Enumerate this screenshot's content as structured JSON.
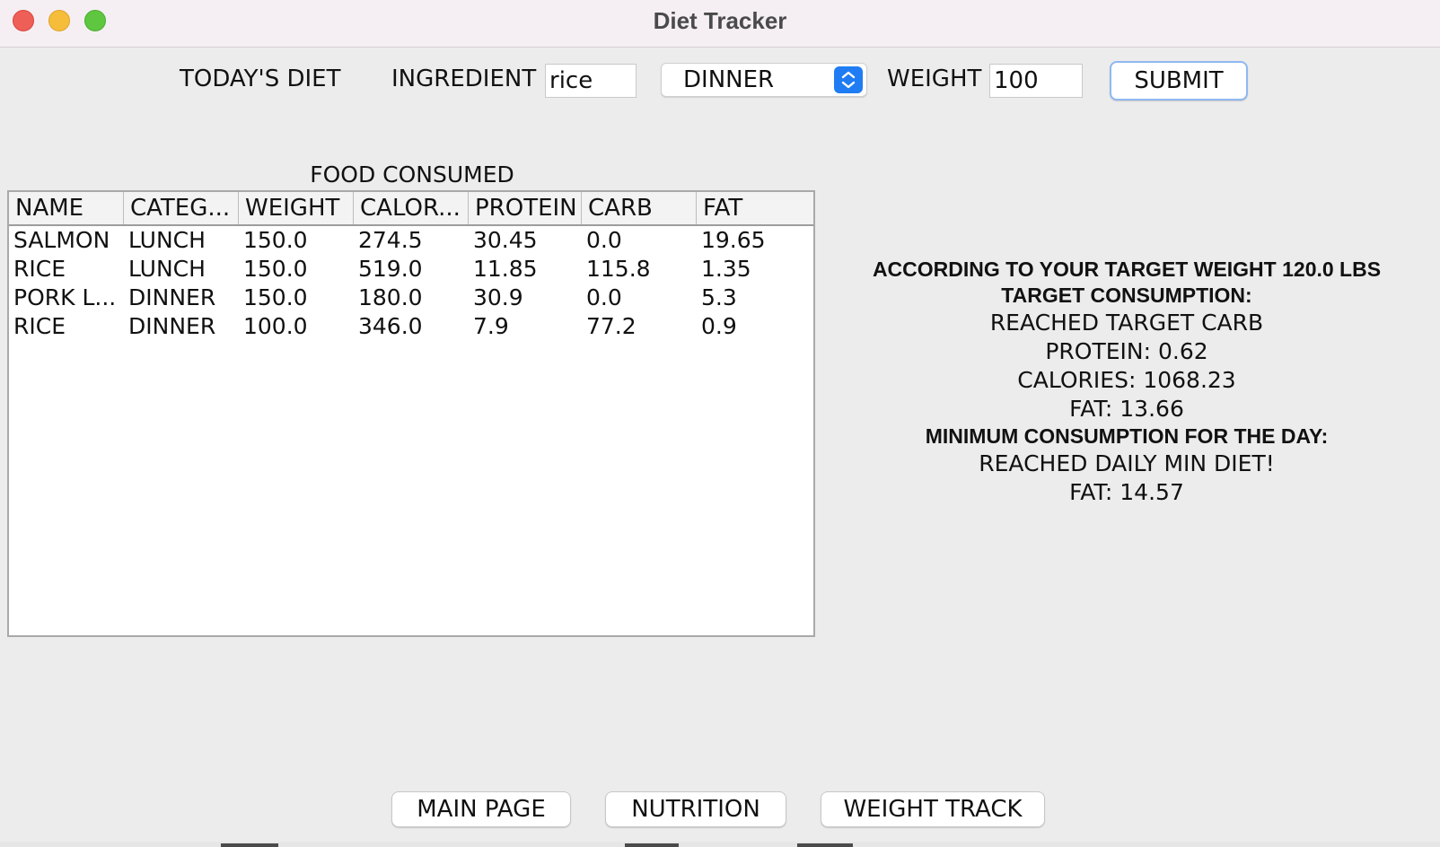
{
  "window": {
    "title": "Diet Tracker"
  },
  "form": {
    "todays_diet_label": "TODAY'S DIET",
    "ingredient_label": "INGREDIENT",
    "ingredient_value": "rice",
    "meal_selected": "DINNER",
    "weight_label": "WEIGHT",
    "weight_value": "100",
    "submit_label": "SUBMIT"
  },
  "table": {
    "title": "FOOD CONSUMED",
    "columns": [
      "NAME",
      "CATEG...",
      "WEIGHT",
      "CALOR...",
      "PROTEIN",
      "CARB",
      "FAT"
    ],
    "rows": [
      [
        "SALMON",
        "LUNCH",
        "150.0",
        "274.5",
        "30.45",
        "0.0",
        "19.65"
      ],
      [
        "RICE",
        "LUNCH",
        "150.0",
        "519.0",
        "11.85",
        "115.8",
        "1.35"
      ],
      [
        "PORK L...",
        "DINNER",
        "150.0",
        "180.0",
        "30.9",
        "0.0",
        "5.3"
      ],
      [
        "RICE",
        "DINNER",
        "100.0",
        "346.0",
        "7.9",
        "77.2",
        "0.9"
      ]
    ]
  },
  "summary": {
    "target_heading": "ACCORDING TO YOUR TARGET WEIGHT 120.0 LBS",
    "target_consumption_heading": "TARGET CONSUMPTION:",
    "target_lines": [
      "REACHED TARGET CARB",
      "PROTEIN: 0.62",
      "CALORIES: 1068.23",
      "FAT: 13.66"
    ],
    "minimum_heading": "MINIMUM CONSUMPTION FOR THE DAY:",
    "minimum_lines": [
      "REACHED DAILY MIN DIET!",
      "FAT: 14.57"
    ]
  },
  "nav": {
    "main_page": "MAIN PAGE",
    "nutrition": "NUTRITION",
    "weight_track": "WEIGHT TRACK"
  },
  "colors": {
    "close": "#ee5f57",
    "minimize": "#f6bd3b",
    "maximize": "#5fc73f",
    "select_accent": "#1f7cf3",
    "focus_ring": "#8fb8f2"
  }
}
